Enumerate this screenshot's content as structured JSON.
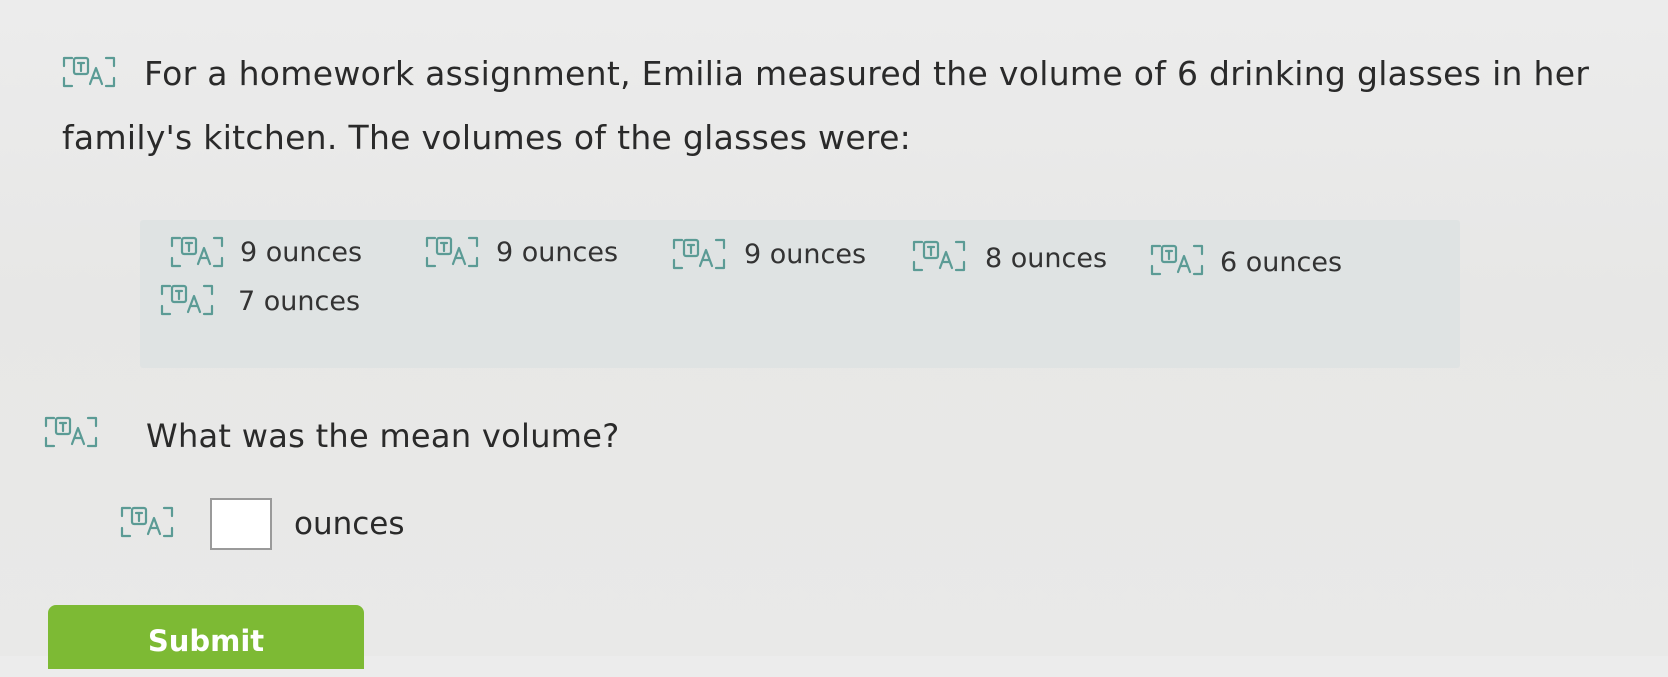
{
  "question": {
    "line1": "For a homework assignment, Emilia measured the volume of 6 drinking glasses in her",
    "line2": "family's kitchen. The volumes of the glasses were:"
  },
  "values": [
    "9 ounces",
    "9 ounces",
    "9 ounces",
    "8 ounces",
    "6 ounces",
    "7 ounces"
  ],
  "prompt": "What was the mean volume?",
  "answer": {
    "value": "",
    "unit": "ounces"
  },
  "submit_label": "Submit",
  "icon": "translate-icon",
  "colors": {
    "submit": "#7dba34",
    "values_bg": "#dfe3e3",
    "icon": "#5b9b95"
  }
}
